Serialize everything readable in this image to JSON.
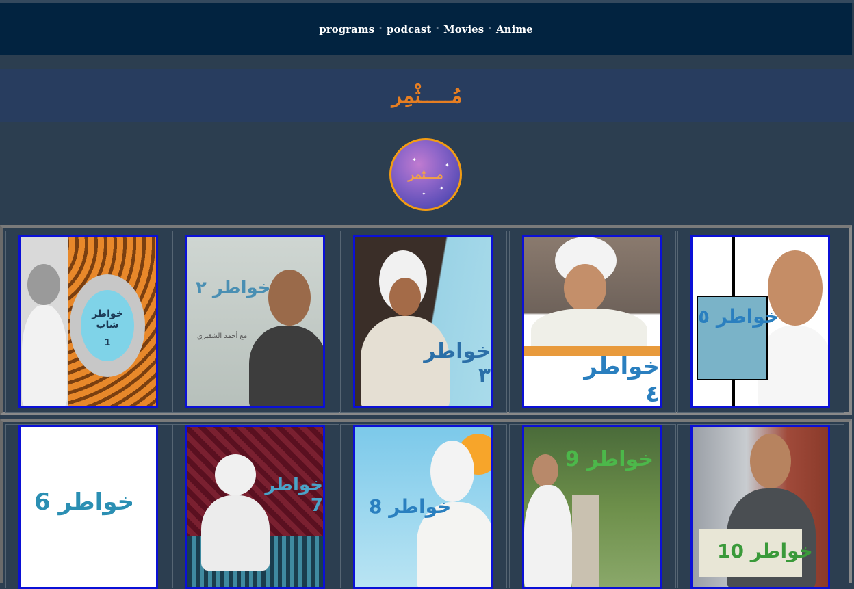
{
  "nav": {
    "items": [
      "programs",
      "podcast",
      "Movies",
      "Anime"
    ]
  },
  "banner": {
    "title": "مُـــــثْمِر"
  },
  "logo": {
    "text": "مـــثمر"
  },
  "colors": {
    "accent": "#e67e22",
    "navbar": "#022340",
    "banner": "#283d5f",
    "page": "#2c3e50",
    "thumb_border": "#0b10d6"
  },
  "gallery": {
    "row1": [
      {
        "title": "خواطر شاب",
        "number": "1"
      },
      {
        "title": "خواطر ٢",
        "subtitle": "مع أحمد الشقيري"
      },
      {
        "title": "خواطر ٣"
      },
      {
        "title": "خواطر ٤"
      },
      {
        "title": "خواطر ٥"
      }
    ],
    "row2": [
      {
        "title": "خواطر 6"
      },
      {
        "title": "خواطر 7"
      },
      {
        "title": "خواطر 8"
      },
      {
        "title": "خواطر 9"
      },
      {
        "title": "خواطر 10"
      }
    ]
  }
}
